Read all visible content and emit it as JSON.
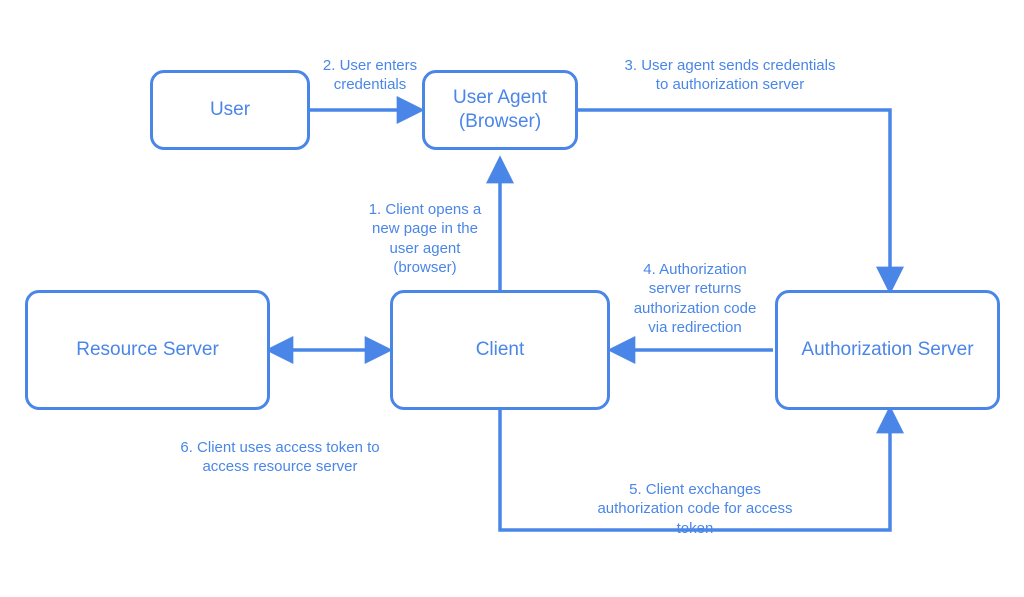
{
  "nodes": {
    "user": "User",
    "user_agent": "User Agent\n(Browser)",
    "client": "Client",
    "resource_server": "Resource Server",
    "authorization_server": "Authorization Server"
  },
  "edges": {
    "step1": "1. Client opens a\nnew page in the\nuser agent\n(browser)",
    "step2": "2. User enters\ncredentials",
    "step3": "3. User agent sends credentials\nto authorization server",
    "step4": "4. Authorization\nserver returns\nauthorization code\nvia redirection",
    "step5": "5. Client exchanges\nauthorization code for access\ntoken",
    "step6": "6. Client uses access token to\naccess resource server"
  },
  "style": {
    "stroke": "#4a86e8"
  }
}
